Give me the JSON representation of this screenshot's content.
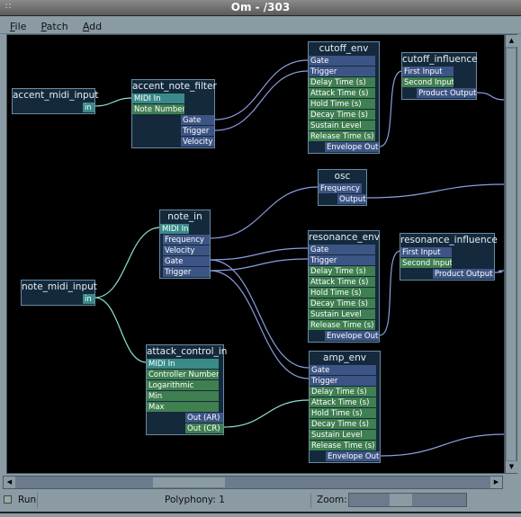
{
  "window": {
    "title": "Om - /303"
  },
  "menu": [
    "File",
    "Patch",
    "Add"
  ],
  "modules": [
    {
      "id": "accent_midi_input",
      "name": "accent_midi_input",
      "ports": [
        {
          "label": "in",
          "kind": "midi",
          "dir": "out"
        }
      ]
    },
    {
      "id": "accent_note_filter",
      "name": "accent_note_filter",
      "ports": [
        {
          "label": "MIDI In",
          "kind": "midi",
          "dir": "in"
        },
        {
          "label": "Note Number",
          "kind": "control",
          "dir": "in"
        },
        {
          "label": "Gate",
          "kind": "audio",
          "dir": "out"
        },
        {
          "label": "Trigger",
          "kind": "audio",
          "dir": "out"
        },
        {
          "label": "Velocity",
          "kind": "audio",
          "dir": "out"
        }
      ]
    },
    {
      "id": "cutoff_env",
      "name": "cutoff_env",
      "ports": [
        {
          "label": "Gate",
          "kind": "audio",
          "dir": "in"
        },
        {
          "label": "Trigger",
          "kind": "audio",
          "dir": "in"
        },
        {
          "label": "Delay Time (s)",
          "kind": "control",
          "dir": "in"
        },
        {
          "label": "Attack Time (s)",
          "kind": "control",
          "dir": "in"
        },
        {
          "label": "Hold Time (s)",
          "kind": "control",
          "dir": "in"
        },
        {
          "label": "Decay Time (s)",
          "kind": "control",
          "dir": "in"
        },
        {
          "label": "Sustain Level",
          "kind": "control",
          "dir": "in"
        },
        {
          "label": "Release Time (s)",
          "kind": "control",
          "dir": "in"
        },
        {
          "label": "Envelope Out",
          "kind": "audio",
          "dir": "out"
        }
      ]
    },
    {
      "id": "cutoff_influence",
      "name": "cutoff_influence",
      "ports": [
        {
          "label": "First Input",
          "kind": "audio",
          "dir": "in"
        },
        {
          "label": "Second Input",
          "kind": "control",
          "dir": "in"
        },
        {
          "label": "Product Output",
          "kind": "audio",
          "dir": "out"
        }
      ]
    },
    {
      "id": "osc",
      "name": "osc",
      "ports": [
        {
          "label": "Frequency",
          "kind": "audio",
          "dir": "in"
        },
        {
          "label": "Output",
          "kind": "audio",
          "dir": "out"
        }
      ]
    },
    {
      "id": "note_in",
      "name": "note_in",
      "ports": [
        {
          "label": "MIDI In",
          "kind": "midi",
          "dir": "in"
        },
        {
          "label": "Frequency",
          "kind": "audio",
          "dir": "out"
        },
        {
          "label": "Velocity",
          "kind": "audio",
          "dir": "out"
        },
        {
          "label": "Gate",
          "kind": "audio",
          "dir": "out"
        },
        {
          "label": "Trigger",
          "kind": "audio",
          "dir": "out"
        }
      ]
    },
    {
      "id": "resonance_env",
      "name": "resonance_env",
      "ports": [
        {
          "label": "Gate",
          "kind": "audio",
          "dir": "in"
        },
        {
          "label": "Trigger",
          "kind": "audio",
          "dir": "in"
        },
        {
          "label": "Delay Time (s)",
          "kind": "control",
          "dir": "in"
        },
        {
          "label": "Attack Time (s)",
          "kind": "control",
          "dir": "in"
        },
        {
          "label": "Hold Time (s)",
          "kind": "control",
          "dir": "in"
        },
        {
          "label": "Decay Time (s)",
          "kind": "control",
          "dir": "in"
        },
        {
          "label": "Sustain Level",
          "kind": "control",
          "dir": "in"
        },
        {
          "label": "Release Time (s)",
          "kind": "control",
          "dir": "in"
        },
        {
          "label": "Envelope Out",
          "kind": "audio",
          "dir": "out"
        }
      ]
    },
    {
      "id": "resonance_influence",
      "name": "resonance_influence",
      "ports": [
        {
          "label": "First Input",
          "kind": "audio",
          "dir": "in"
        },
        {
          "label": "Second Input",
          "kind": "control",
          "dir": "in"
        },
        {
          "label": "Product Output",
          "kind": "audio",
          "dir": "out"
        }
      ]
    },
    {
      "id": "note_midi_input",
      "name": "note_midi_input",
      "ports": [
        {
          "label": "in",
          "kind": "midi",
          "dir": "out"
        }
      ]
    },
    {
      "id": "attack_control_in",
      "name": "attack_control_in",
      "ports": [
        {
          "label": "MIDI In",
          "kind": "midi",
          "dir": "in"
        },
        {
          "label": "Controller Number",
          "kind": "control",
          "dir": "in"
        },
        {
          "label": "Logarithmic",
          "kind": "control",
          "dir": "in"
        },
        {
          "label": "Min",
          "kind": "control",
          "dir": "in"
        },
        {
          "label": "Max",
          "kind": "control",
          "dir": "in"
        },
        {
          "label": "Out (AR)",
          "kind": "audio",
          "dir": "out"
        },
        {
          "label": "Out (CR)",
          "kind": "control",
          "dir": "out"
        }
      ]
    },
    {
      "id": "amp_env",
      "name": "amp_env",
      "ports": [
        {
          "label": "Gate",
          "kind": "audio",
          "dir": "in"
        },
        {
          "label": "Trigger",
          "kind": "audio",
          "dir": "in"
        },
        {
          "label": "Delay Time (s)",
          "kind": "control",
          "dir": "in"
        },
        {
          "label": "Attack Time (s)",
          "kind": "control",
          "dir": "in"
        },
        {
          "label": "Hold Time (s)",
          "kind": "control",
          "dir": "in"
        },
        {
          "label": "Decay Time (s)",
          "kind": "control",
          "dir": "in"
        },
        {
          "label": "Sustain Level",
          "kind": "control",
          "dir": "in"
        },
        {
          "label": "Release Time (s)",
          "kind": "control",
          "dir": "in"
        },
        {
          "label": "Envelope Out",
          "kind": "audio",
          "dir": "out"
        }
      ]
    }
  ],
  "colors": {
    "midi": "#3a8a8a",
    "control": "#3f7f50",
    "audio": "#3d5585",
    "wire_audio": "#8a9ee0",
    "wire_midi": "#8ee0d8"
  },
  "status": {
    "run_label": "Run",
    "run_checked": false,
    "polyphony": "Polyphony: 1",
    "zoom_label": "Zoom:"
  }
}
